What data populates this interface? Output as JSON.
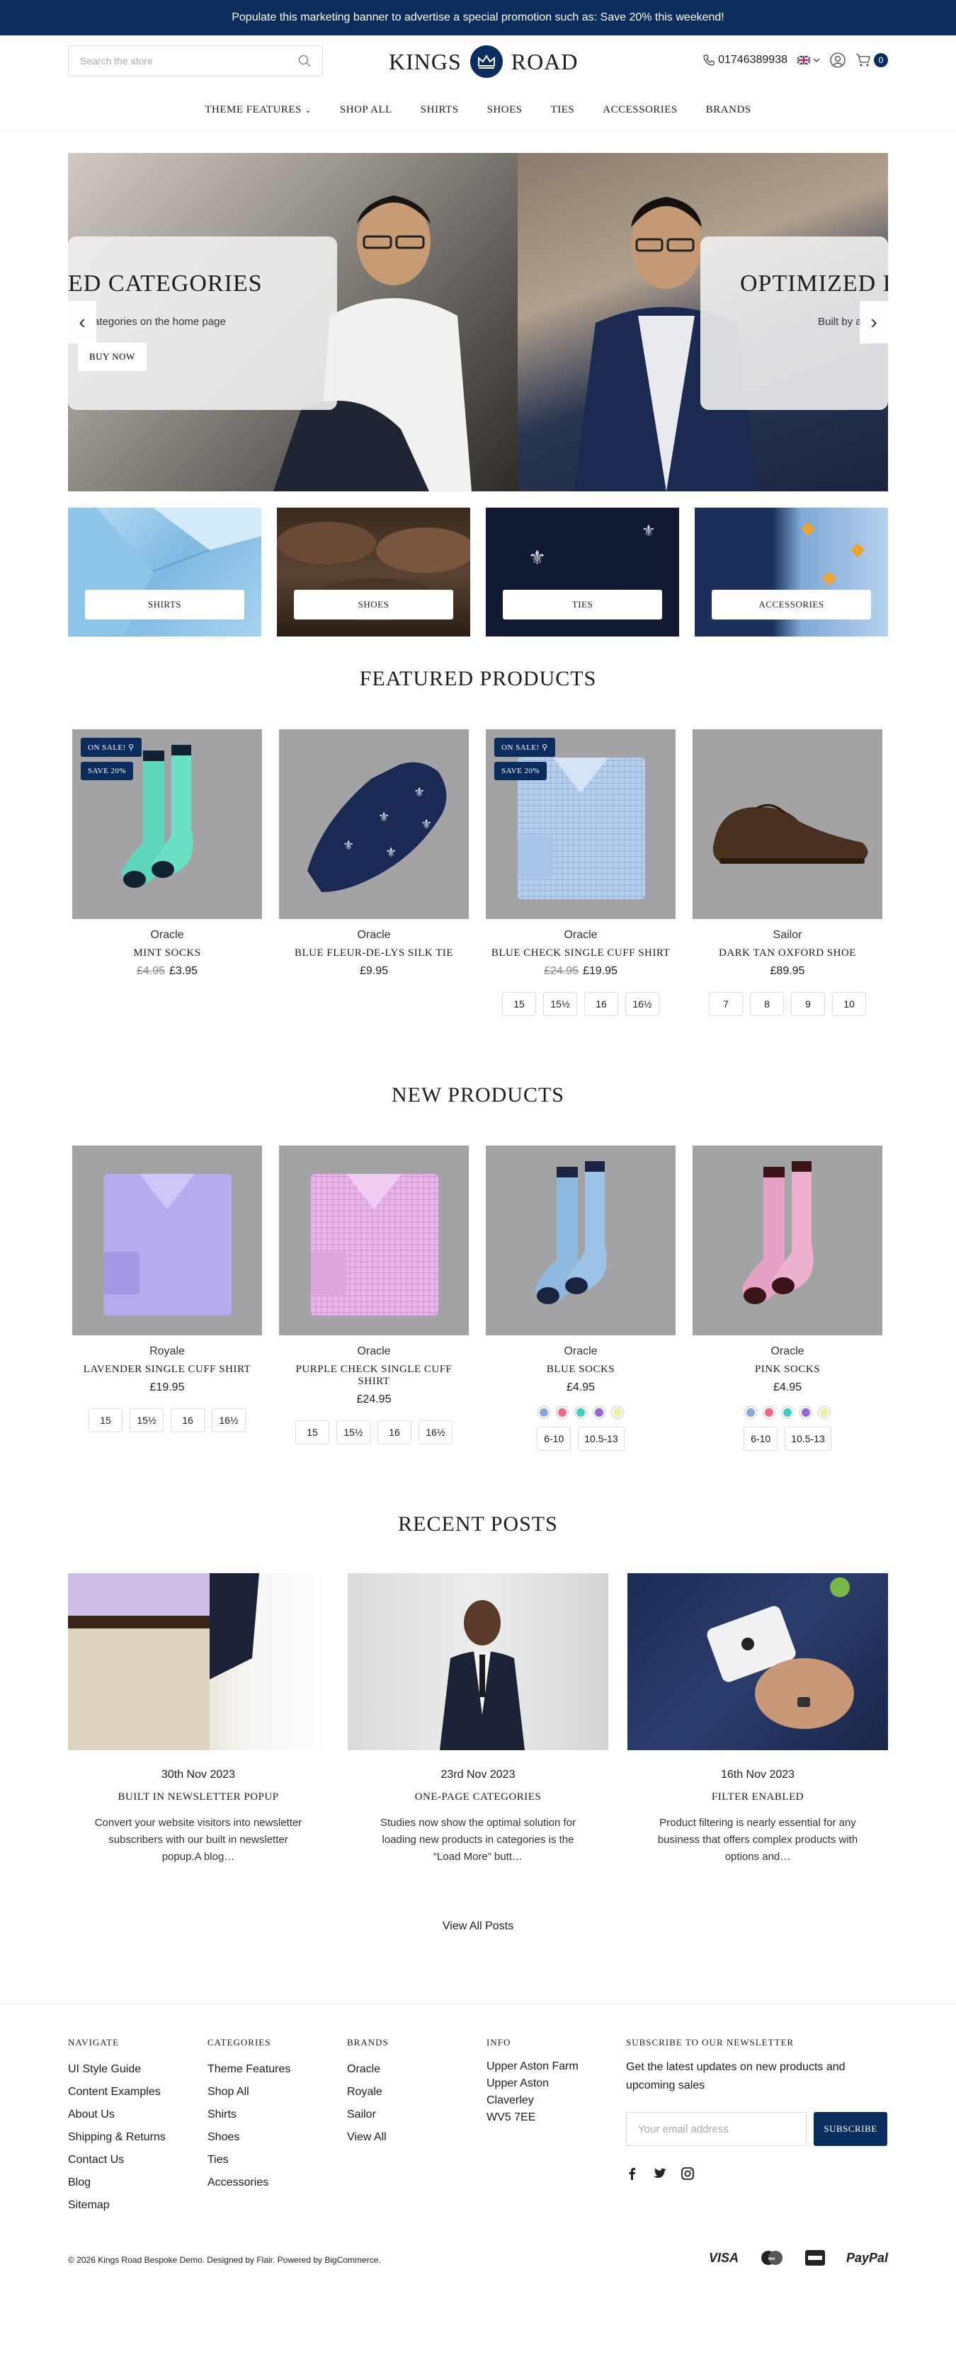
{
  "promo": {
    "text": "Populate this marketing banner to advertise a special promotion such as: Save 20% this weekend!"
  },
  "header": {
    "search_placeholder": "Search the store",
    "logo_left": "KINGS",
    "logo_right": "ROAD",
    "phone": "01746389938",
    "cart_count": "0"
  },
  "nav": {
    "items": [
      "THEME FEATURES",
      "SHOP ALL",
      "SHIRTS",
      "SHOES",
      "TIES",
      "ACCESSORIES",
      "BRANDS"
    ]
  },
  "hero": {
    "slide1_title": "ED CATEGORIES",
    "slide1_sub": "ategories on the home page",
    "slide1_button": "BUY NOW",
    "slide2_title": "OPTIMIZED F",
    "slide2_sub": "Built by a"
  },
  "categories": [
    "SHIRTS",
    "SHOES",
    "TIES",
    "ACCESSORIES"
  ],
  "featured": {
    "title": "FEATURED PRODUCTS",
    "products": [
      {
        "brand": "Oracle",
        "name": "MINT SOCKS",
        "old_price": "£4.95",
        "price": "£3.95",
        "badge1": "ON SALE!",
        "badge2": "SAVE 20%"
      },
      {
        "brand": "Oracle",
        "name": "BLUE FLEUR-DE-LYS SILK TIE",
        "price": "£9.95"
      },
      {
        "brand": "Oracle",
        "name": "BLUE CHECK SINGLE CUFF SHIRT",
        "old_price": "£24.95",
        "price": "£19.95",
        "badge1": "ON SALE!",
        "badge2": "SAVE 20%",
        "sizes": [
          "15",
          "15½",
          "16",
          "16½"
        ]
      },
      {
        "brand": "Sailor",
        "name": "DARK TAN OXFORD SHOE",
        "price": "£89.95",
        "sizes": [
          "7",
          "8",
          "9",
          "10"
        ]
      }
    ]
  },
  "new_products": {
    "title": "NEW PRODUCTS",
    "products": [
      {
        "brand": "Royale",
        "name": "LAVENDER SINGLE CUFF SHIRT",
        "price": "£19.95",
        "sizes": [
          "15",
          "15½",
          "16",
          "16½"
        ]
      },
      {
        "brand": "Oracle",
        "name": "PURPLE CHECK SINGLE CUFF SHIRT",
        "price": "£24.95",
        "sizes": [
          "15",
          "15½",
          "16",
          "16½"
        ]
      },
      {
        "brand": "Oracle",
        "name": "BLUE SOCKS",
        "price": "£4.95",
        "sizes": [
          "6-10",
          "10.5-13"
        ]
      },
      {
        "brand": "Oracle",
        "name": "PINK SOCKS",
        "price": "£4.95",
        "sizes": [
          "6-10",
          "10.5-13"
        ]
      }
    ],
    "swatch_colors": [
      "#8ea6d4",
      "#e96a8a",
      "#3fd0c0",
      "#9a63d6",
      "#eef0a8"
    ]
  },
  "posts": {
    "title": "RECENT POSTS",
    "items": [
      {
        "date": "30th Nov 2023",
        "title": "BUILT IN NEWSLETTER POPUP",
        "excerpt": "Convert your website visitors into newsletter subscribers with our built in newsletter popup.A blog…"
      },
      {
        "date": "23rd Nov 2023",
        "title": "ONE-PAGE CATEGORIES",
        "excerpt": "Studies now show the optimal solution for loading new products in categories is the “Load More” butt…"
      },
      {
        "date": "16th Nov 2023",
        "title": "FILTER ENABLED",
        "excerpt": "Product filtering is nearly essential for any business that offers complex products with options and…"
      }
    ],
    "view_all": "View All Posts"
  },
  "footer": {
    "navigate": {
      "title": "NAVIGATE",
      "links": [
        "UI Style Guide",
        "Content Examples",
        "About Us",
        "Shipping & Returns",
        "Contact Us",
        "Blog",
        "Sitemap"
      ]
    },
    "categories": {
      "title": "CATEGORIES",
      "links": [
        "Theme Features",
        "Shop All",
        "Shirts",
        "Shoes",
        "Ties",
        "Accessories"
      ]
    },
    "brands": {
      "title": "BRANDS",
      "links": [
        "Oracle",
        "Royale",
        "Sailor",
        "View All"
      ]
    },
    "info": {
      "title": "INFO",
      "lines": [
        "Upper Aston Farm",
        "Upper Aston",
        "Claverley",
        "WV5 7EE"
      ]
    },
    "newsletter": {
      "title": "SUBSCRIBE TO OUR NEWSLETTER",
      "text": "Get the latest updates on new products and upcoming sales",
      "placeholder": "Your email address",
      "button": "SUBSCRIBE"
    },
    "copyright": "© 2026 Kings Road Bespoke Demo.  Designed by Flair.  Powered by BigCommerce.",
    "payments": [
      "VISA",
      "PayPal"
    ]
  },
  "colors": {
    "brand_navy": "#0b2d5e",
    "product_bg": "#a3a3a5"
  }
}
